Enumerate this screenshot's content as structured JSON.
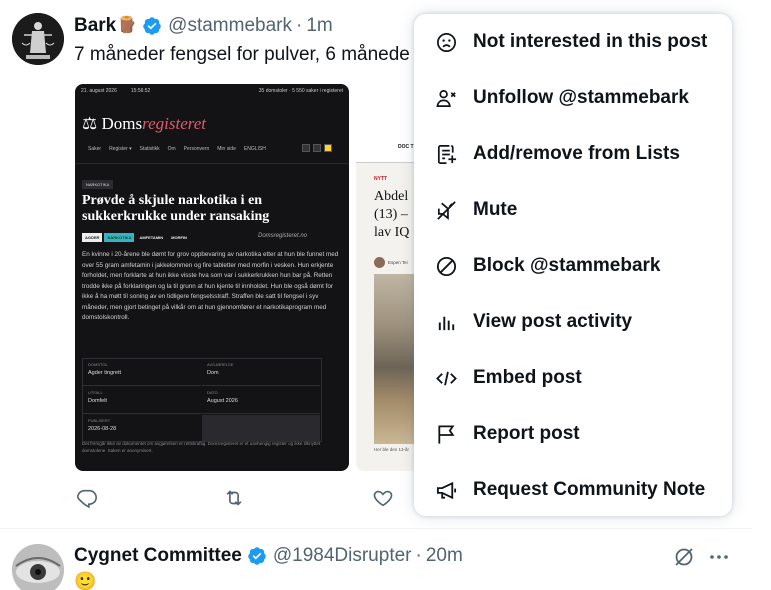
{
  "post1": {
    "display_name": "Bark",
    "name_emoji": "🪵",
    "handle": "@stammebark",
    "separator": "·",
    "time": "1m",
    "text": "7 måneder fengsel for pulver, 6 månede",
    "media1": {
      "date": "21. august 2026",
      "time": "15:56:52",
      "stats": "35 domstoler · 5 550 saker i registeret",
      "logo_plain": "Doms",
      "logo_accent": "registeret",
      "nav": [
        "Saker",
        "Register ▾",
        "Statistikk",
        "Om",
        "Personvern",
        "Min side",
        "ENGLISH"
      ],
      "tag": "NARKOTIKA",
      "headline": "Prøvde å skjule narkotika i en sukkerkrukke under ransaking",
      "tags": [
        "AGDER",
        "NARKOTIKA",
        "AMFETAMIN",
        "MORFIN"
      ],
      "brand": "Domsregisteret.no",
      "body": "En kvinne i 20-årene ble dømt for grov oppbevaring av narkotika etter at hun ble funnet med over 55 gram amfetamin i jakkelommen og fire tabletter med morfin i vesken. Hun erkjente forholdet, men forklarte at hun ikke visste hva som var i sukkerkrukken hun bar på. Retten trodde ikke på forklaringen og la til grunn at hun kjente til innholdet. Hun ble også dømt for ikke å ha møtt til soning av en tidligere fengselsstraff. Straffen ble satt til fengsel i syv måneder, men gjort betinget på vilkår om at hun gjennomfører et narkotikaprogram med domstolskontroll.",
      "table": [
        {
          "k": "DOMSTOL",
          "v": "Agder tingrett"
        },
        {
          "k": "AVGJØRELSE",
          "v": "Dom"
        },
        {
          "k": "UTFALL",
          "v": "Domfelt"
        },
        {
          "k": "DATO",
          "v": "August 2026"
        },
        {
          "k": "PUBLISERT",
          "v": "2026-08-28"
        }
      ],
      "footer": "Det fremgår ikke av dokumentet om avgjørelsen er rettskraftig. Domsregisteret er et uavhengig register og ikke tilknyttet domstolene. Saken er anonymisert."
    },
    "media2": {
      "doc": "DOC T",
      "section": "NYTT",
      "headline_lines": [
        "Abdel",
        "(13) –",
        "lav IQ"
      ],
      "author": "Espen Tei",
      "caption": "Her ble den 13-år"
    }
  },
  "menu": {
    "items": [
      {
        "label": "Not interested in this post",
        "icon": "frown-face-icon"
      },
      {
        "label": "Unfollow @stammebark",
        "icon": "unfollow-user-icon"
      },
      {
        "label": "Add/remove from Lists",
        "icon": "list-add-icon"
      },
      {
        "label": "Mute",
        "icon": "mute-icon"
      },
      {
        "label": "Block @stammebark",
        "icon": "block-icon"
      },
      {
        "label": "View post activity",
        "icon": "activity-chart-icon"
      },
      {
        "label": "Embed post",
        "icon": "embed-code-icon"
      },
      {
        "label": "Report post",
        "icon": "flag-icon"
      },
      {
        "label": "Request Community Note",
        "icon": "megaphone-icon"
      }
    ]
  },
  "post2": {
    "display_name": "Cygnet Committee",
    "handle": "@1984Disrupter",
    "separator": "·",
    "time": "20m",
    "text": "🙂"
  },
  "colors": {
    "verified": "#1d9bf0",
    "secondary_text": "#536471",
    "action_icon": "#536471"
  }
}
